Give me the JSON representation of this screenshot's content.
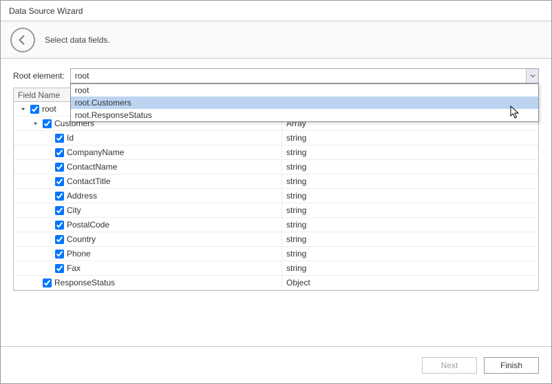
{
  "window": {
    "title": "Data Source Wizard"
  },
  "subheader": {
    "subtitle": "Select data fields."
  },
  "root_element": {
    "label": "Root element:",
    "value": "root"
  },
  "dropdown": {
    "options": [
      {
        "label": "root",
        "selected": false
      },
      {
        "label": "root.Customers",
        "selected": true
      },
      {
        "label": "root.ResponseStatus",
        "selected": false
      }
    ]
  },
  "grid": {
    "headers": {
      "col1": "Field Name",
      "col2": ""
    },
    "rows": [
      {
        "indent": 0,
        "expander": "open",
        "checked": true,
        "name": "root",
        "type": ""
      },
      {
        "indent": 1,
        "expander": "open",
        "checked": true,
        "name": "Customers",
        "type": "Array"
      },
      {
        "indent": 2,
        "expander": "none",
        "checked": true,
        "name": "Id",
        "type": "string"
      },
      {
        "indent": 2,
        "expander": "none",
        "checked": true,
        "name": "CompanyName",
        "type": "string"
      },
      {
        "indent": 2,
        "expander": "none",
        "checked": true,
        "name": "ContactName",
        "type": "string"
      },
      {
        "indent": 2,
        "expander": "none",
        "checked": true,
        "name": "ContactTitle",
        "type": "string"
      },
      {
        "indent": 2,
        "expander": "none",
        "checked": true,
        "name": "Address",
        "type": "string"
      },
      {
        "indent": 2,
        "expander": "none",
        "checked": true,
        "name": "City",
        "type": "string"
      },
      {
        "indent": 2,
        "expander": "none",
        "checked": true,
        "name": "PostalCode",
        "type": "string"
      },
      {
        "indent": 2,
        "expander": "none",
        "checked": true,
        "name": "Country",
        "type": "string"
      },
      {
        "indent": 2,
        "expander": "none",
        "checked": true,
        "name": "Phone",
        "type": "string"
      },
      {
        "indent": 2,
        "expander": "none",
        "checked": true,
        "name": "Fax",
        "type": "string"
      },
      {
        "indent": 1,
        "expander": "none",
        "checked": true,
        "name": "ResponseStatus",
        "type": "Object"
      }
    ]
  },
  "footer": {
    "next": "Next",
    "finish": "Finish"
  }
}
